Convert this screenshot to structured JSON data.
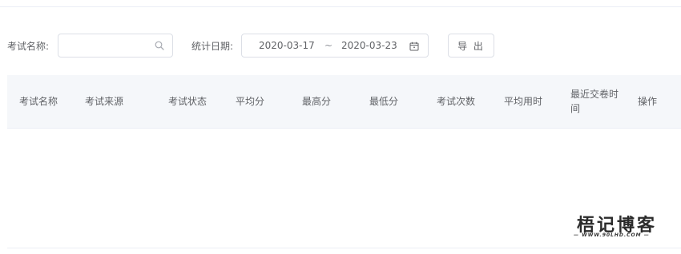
{
  "filters": {
    "exam_name_label": "考试名称:",
    "exam_name_value": "",
    "exam_name_placeholder": "",
    "date_label": "统计日期:",
    "date_start": "2020-03-17",
    "date_separator": "~",
    "date_end": "2020-03-23",
    "export_label": "导 出"
  },
  "table": {
    "columns": [
      "考试名称",
      "考试来源",
      "考试状态",
      "平均分",
      "最高分",
      "最低分",
      "考试次数",
      "平均用时",
      "最近交卷时间",
      "操作"
    ],
    "rows": []
  },
  "watermark": {
    "title": "梧记博客",
    "url": "— WWW.90LHD.COM —"
  },
  "icons": {
    "search": "search-icon",
    "calendar": "calendar-icon"
  },
  "colors": {
    "border": "#dcdfe6",
    "header_bg": "#f5f7fa",
    "text": "#606266"
  }
}
